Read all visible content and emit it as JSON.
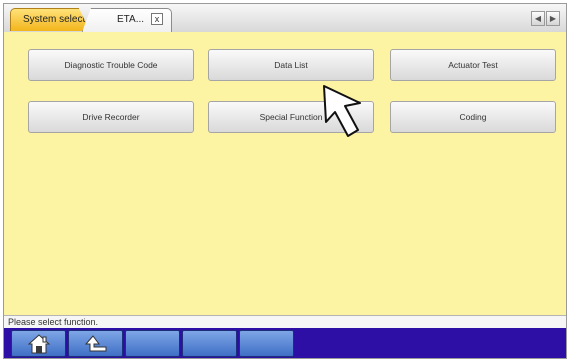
{
  "tabs": {
    "system_select": "System select",
    "eta_label": "ETA...",
    "close_glyph": "x",
    "prev_glyph": "◀",
    "next_glyph": "▶"
  },
  "functions": [
    {
      "id": "dtc",
      "label": "Diagnostic Trouble Code"
    },
    {
      "id": "data-list",
      "label": "Data List"
    },
    {
      "id": "actuator-test",
      "label": "Actuator Test"
    },
    {
      "id": "drive-recorder",
      "label": "Drive Recorder"
    },
    {
      "id": "special-function",
      "label": "Special Function"
    },
    {
      "id": "coding",
      "label": "Coding"
    }
  ],
  "status_text": "Please select function.",
  "bottom_bar": {
    "buttons": [
      "home-icon",
      "back-icon",
      "",
      "",
      ""
    ]
  },
  "colors": {
    "content_bg": "#fdf4a3",
    "active_tab": "#f2b51c",
    "bottom_bar": "#2d0fa6"
  }
}
